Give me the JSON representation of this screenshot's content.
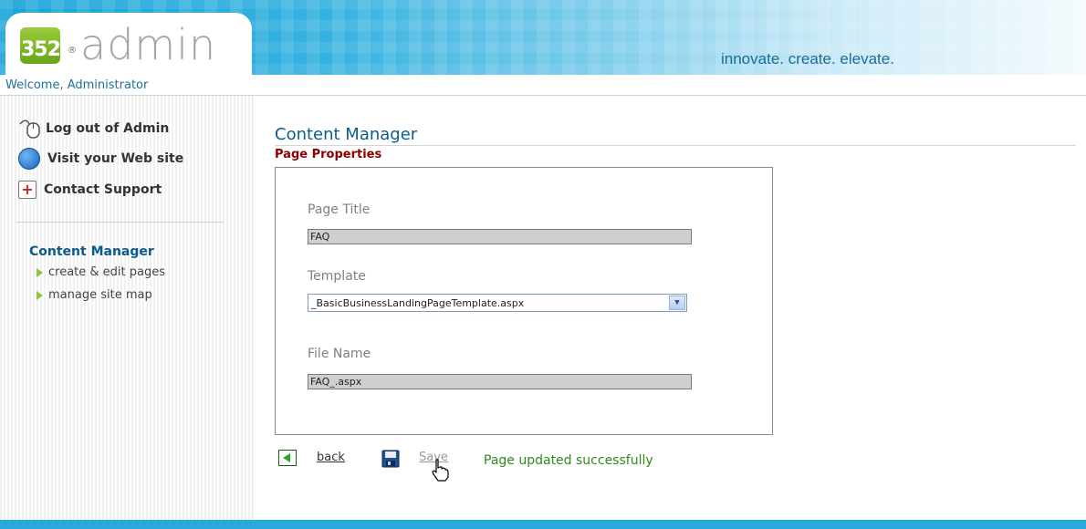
{
  "header": {
    "logo_number": "352",
    "logo_registered": "®",
    "logo_text": "admin",
    "tagline": "innovate. create. elevate.",
    "welcome": "Welcome, Administrator"
  },
  "sidebar": {
    "links": [
      {
        "label": "Log out of Admin",
        "icon": "mouse-icon"
      },
      {
        "label": "Visit your Web site",
        "icon": "globe-icon"
      },
      {
        "label": "Contact Support",
        "icon": "plus-icon"
      }
    ],
    "section_title": "Content Manager",
    "sub_items": [
      {
        "label": "create & edit pages"
      },
      {
        "label": "manage site map"
      }
    ]
  },
  "main": {
    "title": "Content Manager",
    "subtitle": "Page Properties",
    "fields": {
      "page_title_label": "Page Title",
      "page_title_value": "FAQ",
      "template_label": "Template",
      "template_value": "_BasicBusinessLandingPageTemplate.aspx",
      "file_name_label": "File Name",
      "file_name_value": "FAQ_.aspx"
    },
    "actions": {
      "back_label": "back",
      "save_label": "Save"
    },
    "status_message": "Page updated successfully"
  },
  "colors": {
    "accent": "#0d5b8c",
    "subtitle": "#8b0000",
    "success": "#2d8a1d",
    "header_blue": "#1aa4d8",
    "logo_green": "#8dc63f"
  }
}
